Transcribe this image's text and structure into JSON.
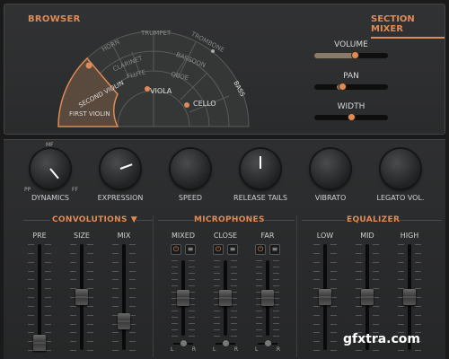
{
  "browser": {
    "title": "BROWSER",
    "outer_ring": [
      "HORN",
      "TRUMPET",
      "TROMBONE"
    ],
    "middle_ring": [
      "CLARINET",
      "BASSOON"
    ],
    "inner_ring": [
      "FLUTE",
      "OBOE"
    ],
    "strings": {
      "first_violin": "FIRST VIOLIN",
      "second_violin": "SECOND VIOLIN",
      "viola": "VIOLA",
      "cello": "CELLO",
      "bass": "BASS"
    }
  },
  "section_mixer": {
    "title": "SECTION MIXER",
    "volume": {
      "label": "VOLUME",
      "value": 0.55
    },
    "pan": {
      "label": "PAN",
      "value": 0.38
    },
    "width": {
      "label": "WIDTH",
      "value": 0.5
    }
  },
  "knobs": {
    "dynamics": {
      "label": "DYNAMICS",
      "pp": "PP",
      "mf": "MF",
      "ff": "FF"
    },
    "expression": {
      "label": "EXPRESSION"
    },
    "speed": {
      "label": "SPEED"
    },
    "release_tails": {
      "label": "RELEASE TAILS"
    },
    "vibrato": {
      "label": "VIBRATO"
    },
    "legato_vol": {
      "label": "LEGATO VOL."
    }
  },
  "convolutions": {
    "title": "CONVOLUTIONS",
    "channels": [
      "PRE",
      "SIZE",
      "MIX"
    ],
    "levels": [
      0.03,
      0.5,
      0.25
    ]
  },
  "microphones": {
    "title": "MICROPHONES",
    "channels": [
      "MIXED",
      "CLOSE",
      "FAR"
    ],
    "levels": [
      0.5,
      0.5,
      0.5
    ],
    "pan_l": "L",
    "pan_r": "R"
  },
  "equalizer": {
    "title": "EQUALIZER",
    "channels": [
      "LOW",
      "MID",
      "HIGH"
    ],
    "levels": [
      0.5,
      0.5,
      0.5
    ]
  },
  "watermark": "gfxtra.com",
  "colors": {
    "accent": "#e08a55",
    "panel": "#2e2f30"
  }
}
